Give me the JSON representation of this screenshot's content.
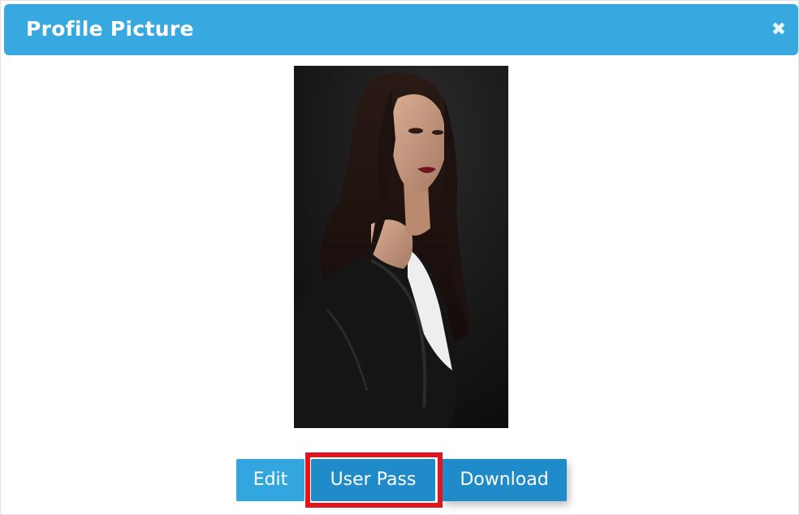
{
  "dialog": {
    "title": "Profile Picture",
    "close_icon": "close-icon",
    "header_color": "#38a9e0"
  },
  "photo": {
    "description_icon": "profile-photo"
  },
  "actions": {
    "edit_label": "Edit",
    "user_pass_label": "User Pass",
    "download_label": "Download"
  },
  "annotation": {
    "highlight_color": "#e3141e"
  }
}
